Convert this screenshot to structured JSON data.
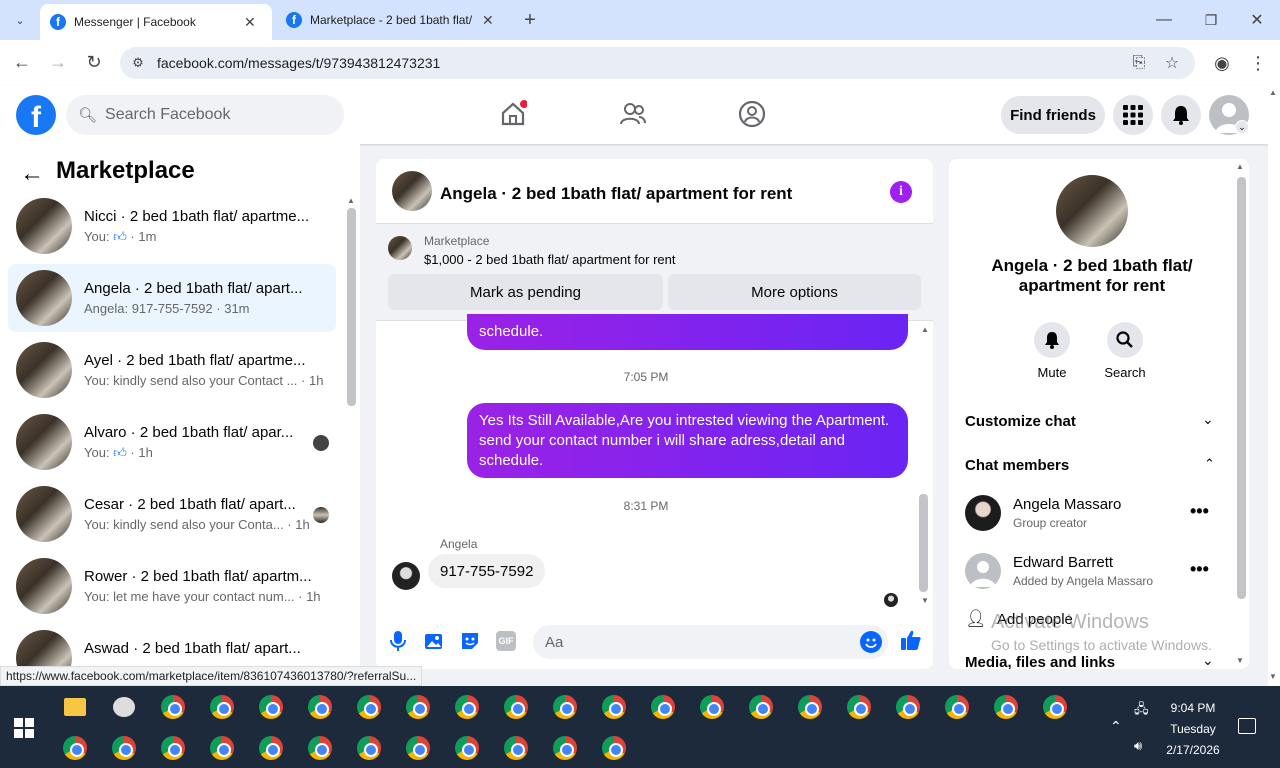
{
  "browser": {
    "tabs": [
      {
        "title": "Messenger | Facebook"
      },
      {
        "title": "Marketplace - 2 bed 1bath flat/"
      }
    ],
    "url": "facebook.com/messages/t/973943812473231"
  },
  "fb": {
    "search_placeholder": "Search Facebook",
    "find_friends": "Find friends"
  },
  "left": {
    "title": "Marketplace",
    "conversations": [
      {
        "title": "Nicci · 2 bed 1bath flat/ apartme...",
        "prefix": "You:",
        "time": "1m"
      },
      {
        "title": "Angela · 2 bed 1bath flat/ apart...",
        "sub": "Angela: 917-755-7592 · 31m"
      },
      {
        "title": "Ayel · 2 bed 1bath flat/ apartme...",
        "sub": "You: kindly send also your Contact ... · 1h"
      },
      {
        "title": "Alvaro · 2 bed 1bath flat/ apar...",
        "prefix": "You:",
        "time": "1h"
      },
      {
        "title": "Cesar · 2 bed 1bath flat/ apart...",
        "sub": "You: kindly send also your Conta... · 1h"
      },
      {
        "title": "Rower · 2 bed 1bath flat/ apartm...",
        "sub": "You: let me have your contact num... · 1h"
      },
      {
        "title": "Aswad · 2 bed 1bath flat/ apart...",
        "sub": ""
      }
    ]
  },
  "chat": {
    "header_title": "Angela · 2 bed 1bath flat/ apartment for rent",
    "listing_source": "Marketplace",
    "listing_desc": "$1,000 - 2 bed 1bath flat/ apartment for rent",
    "mark_pending": "Mark as pending",
    "more_options": "More options",
    "prev_bubble_tail": "schedule.",
    "time1": "7:05 PM",
    "message1": "Yes Its Still Available,Are you intrested viewing the Apartment. send your contact number i will share adress,detail and schedule.",
    "time2": "8:31 PM",
    "sender": "Angela",
    "message2": "917-755-7592",
    "composer_placeholder": "Aa"
  },
  "info": {
    "title": "Angela · 2 bed 1bath flat/ apartment for rent",
    "mute": "Mute",
    "search": "Search",
    "customize": "Customize chat",
    "members_header": "Chat members",
    "members": [
      {
        "name": "Angela Massaro",
        "role": "Group creator"
      },
      {
        "name": "Edward Barrett",
        "role": "Added by Angela Massaro"
      }
    ],
    "add_people": "Add people",
    "media": "Media, files and links",
    "watermark1": "Activate Windows",
    "watermark2": "Go to Settings to activate Windows."
  },
  "status_url": "https://www.facebook.com/marketplace/item/836107436013780/?referralSu...",
  "clock": {
    "time": "9:04 PM",
    "day": "Tuesday",
    "date": "2/17/2026"
  },
  "colors": {
    "fb_blue": "#1877f2",
    "bubble_start": "#9b22e6",
    "bubble_end": "#6a24f4"
  }
}
